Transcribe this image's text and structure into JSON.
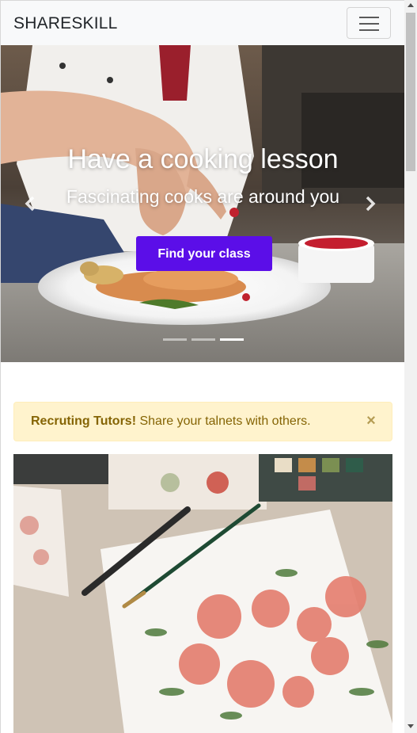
{
  "navbar": {
    "brand": "SHARESKILL",
    "toggler_icon": "hamburger-icon"
  },
  "carousel": {
    "title": "Have a cooking lesson",
    "subtitle": "Fascinating cooks are around you",
    "cta_label": "Find your class",
    "prev_icon": "chevron-left-icon",
    "next_icon": "chevron-right-icon",
    "indicator_count": 3,
    "active_indicator": 3,
    "accent_color": "#5b0ee8"
  },
  "alert": {
    "strong": "Recruting Tutors!",
    "text": " Share your talnets with others.",
    "close": "×",
    "background": "#fff3cd",
    "color": "#856404"
  },
  "card": {
    "image": "watercolor-flowers-illustration"
  }
}
